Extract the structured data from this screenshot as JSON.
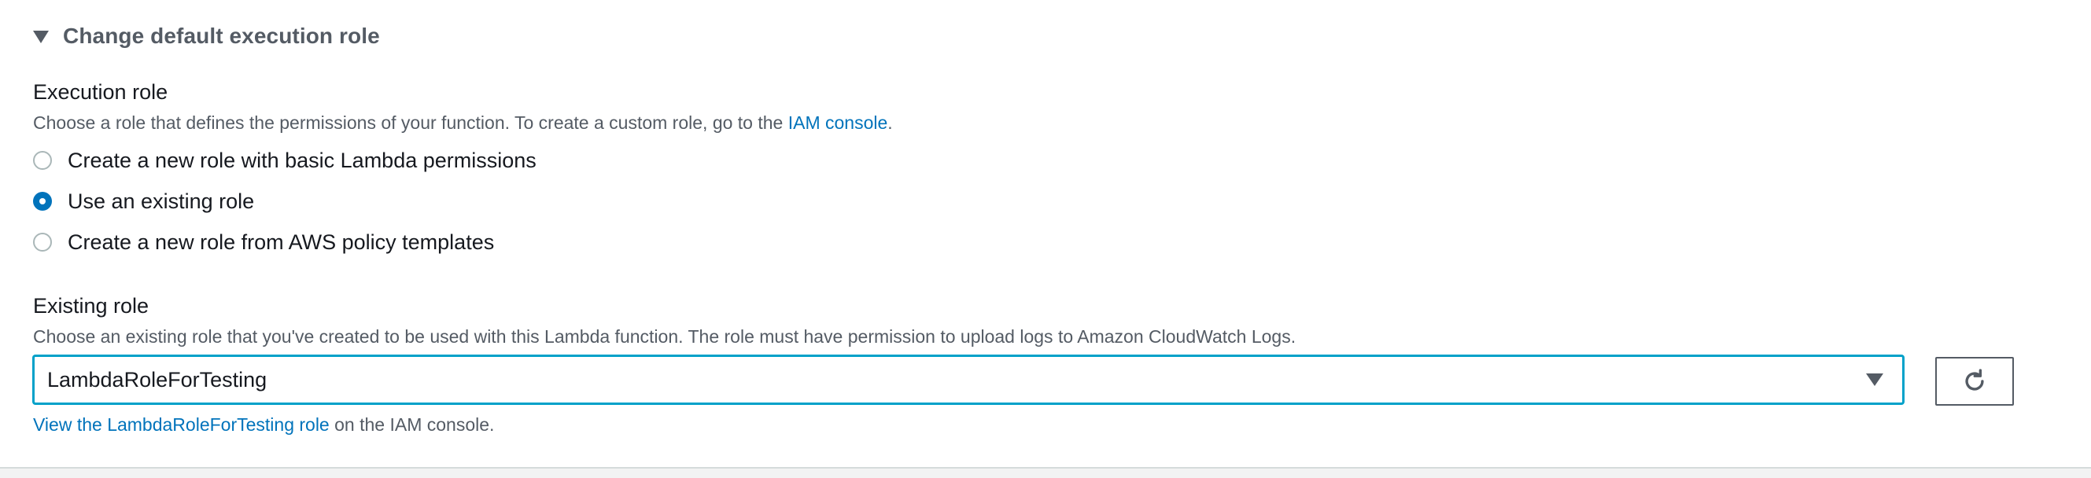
{
  "section": {
    "title": "Change default execution role",
    "expanded": true
  },
  "execution_role": {
    "label": "Execution role",
    "description_prefix": "Choose a role that defines the permissions of your function. To create a custom role, go to the ",
    "description_link": "IAM console",
    "description_suffix": ".",
    "options": [
      {
        "label": "Create a new role with basic Lambda permissions",
        "selected": false
      },
      {
        "label": "Use an existing role",
        "selected": true
      },
      {
        "label": "Create a new role from AWS policy templates",
        "selected": false
      }
    ]
  },
  "existing_role": {
    "label": "Existing role",
    "description": "Choose an existing role that you've created to be used with this Lambda function. The role must have permission to upload logs to Amazon CloudWatch Logs.",
    "selected_value": "LambdaRoleForTesting",
    "view_link": "View the LambdaRoleForTesting role",
    "view_suffix": " on the IAM console."
  },
  "icons": {
    "section_toggle": "caret-down-icon",
    "select_caret": "caret-down-icon",
    "refresh": "refresh-icon"
  },
  "colors": {
    "link": "#0073bb",
    "radio_selected": "#0073bb",
    "focus_border": "#00a1c9",
    "muted_text": "#545b64"
  }
}
